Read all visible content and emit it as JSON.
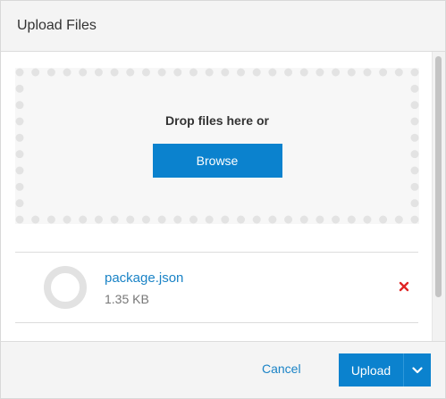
{
  "dialog": {
    "title": "Upload Files"
  },
  "dropzone": {
    "text": "Drop files here or",
    "browse_label": "Browse"
  },
  "files": [
    {
      "name": "package.json",
      "size": "1.35 KB",
      "remove_icon": "close-icon",
      "status_icon": "ring-icon"
    }
  ],
  "footer": {
    "cancel_label": "Cancel",
    "upload_label": "Upload",
    "dropdown_icon": "chevron-down-icon"
  },
  "colors": {
    "accent": "#0b82ce",
    "link": "#1a83c6",
    "remove": "#e02424"
  }
}
